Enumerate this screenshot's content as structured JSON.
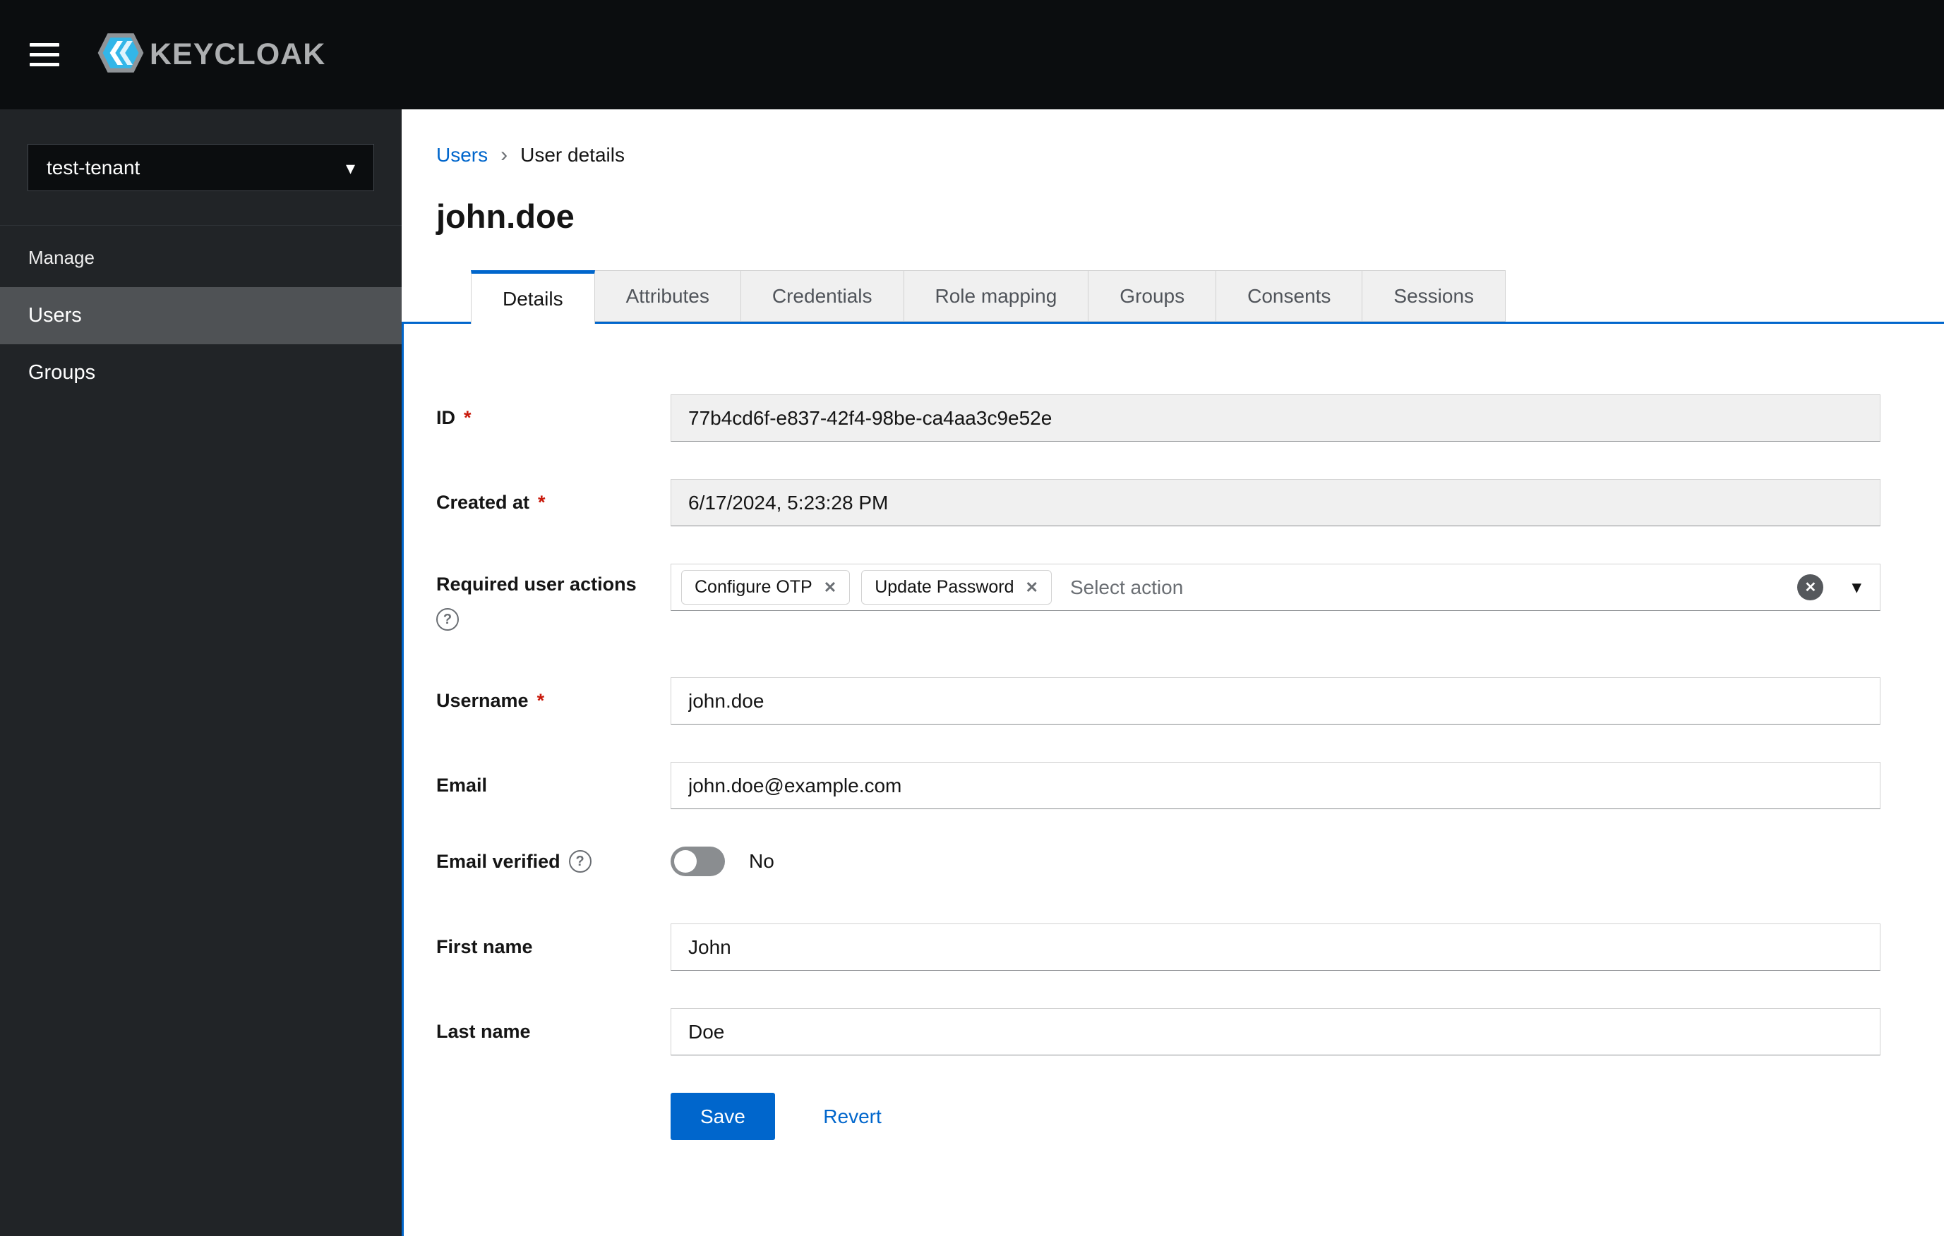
{
  "masthead": {
    "brand_text": "KEYCLOAK"
  },
  "sidebar": {
    "realm_selector": "test-tenant",
    "section_label": "Manage",
    "items": [
      {
        "label": "Users",
        "active": true
      },
      {
        "label": "Groups",
        "active": false
      }
    ]
  },
  "breadcrumb": {
    "root": "Users",
    "current": "User details"
  },
  "page_title": "john.doe",
  "tabs": [
    {
      "label": "Details",
      "active": true
    },
    {
      "label": "Attributes",
      "active": false
    },
    {
      "label": "Credentials",
      "active": false
    },
    {
      "label": "Role mapping",
      "active": false
    },
    {
      "label": "Groups",
      "active": false
    },
    {
      "label": "Consents",
      "active": false
    },
    {
      "label": "Sessions",
      "active": false
    }
  ],
  "form": {
    "id": {
      "label": "ID",
      "required": true,
      "readonly": true,
      "value": "77b4cd6f-e837-42f4-98be-ca4aa3c9e52e"
    },
    "created_at": {
      "label": "Created at",
      "required": true,
      "readonly": true,
      "value": "6/17/2024, 5:23:28 PM"
    },
    "required_user_actions": {
      "label": "Required user actions",
      "chips": [
        "Configure OTP",
        "Update Password"
      ],
      "placeholder": "Select action"
    },
    "username": {
      "label": "Username",
      "required": true,
      "value": "john.doe"
    },
    "email": {
      "label": "Email",
      "value": "john.doe@example.com"
    },
    "email_verified": {
      "label": "Email verified",
      "value": "No",
      "enabled": false
    },
    "first_name": {
      "label": "First name",
      "value": "John"
    },
    "last_name": {
      "label": "Last name",
      "value": "Doe"
    }
  },
  "actions": {
    "save": "Save",
    "revert": "Revert"
  },
  "icons": {
    "chevron_down": "▾",
    "breadcrumb_separator": "›",
    "close": "✕",
    "clear": "✕",
    "question": "?",
    "asterisk": "*"
  },
  "colors": {
    "accent": "#0066cc",
    "required": "#c9190b",
    "masthead_bg": "#0b0d0f",
    "sidebar_bg": "#212427",
    "nav_active_bg": "#4f5255",
    "readonly_bg": "#f0f0f0"
  }
}
